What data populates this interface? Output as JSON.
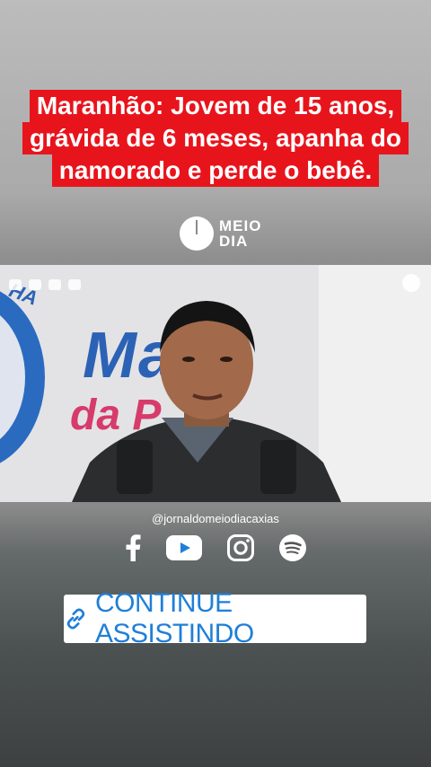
{
  "headline": {
    "lines": [
      "Maranhão: Jovem de 15 anos,",
      "grávida de 6 meses, apanha do",
      "namorado e perde o bebê."
    ],
    "background_color": "#e8141c"
  },
  "brand_logo": {
    "text": "MEIO DIA",
    "line1": "MEIO",
    "line2": "DIA"
  },
  "video": {
    "banner_text_1": "Ma",
    "banner_text_2": "da P",
    "banner_tag": "HA"
  },
  "social": {
    "handle": "@jornaldomeiodiacaxias",
    "icons": [
      "facebook-icon",
      "youtube-icon",
      "instagram-icon",
      "spotify-icon"
    ]
  },
  "cta": {
    "label": "CONTINUE ASSISTINDO",
    "icon": "link-icon",
    "color": "#1f7fd8"
  }
}
